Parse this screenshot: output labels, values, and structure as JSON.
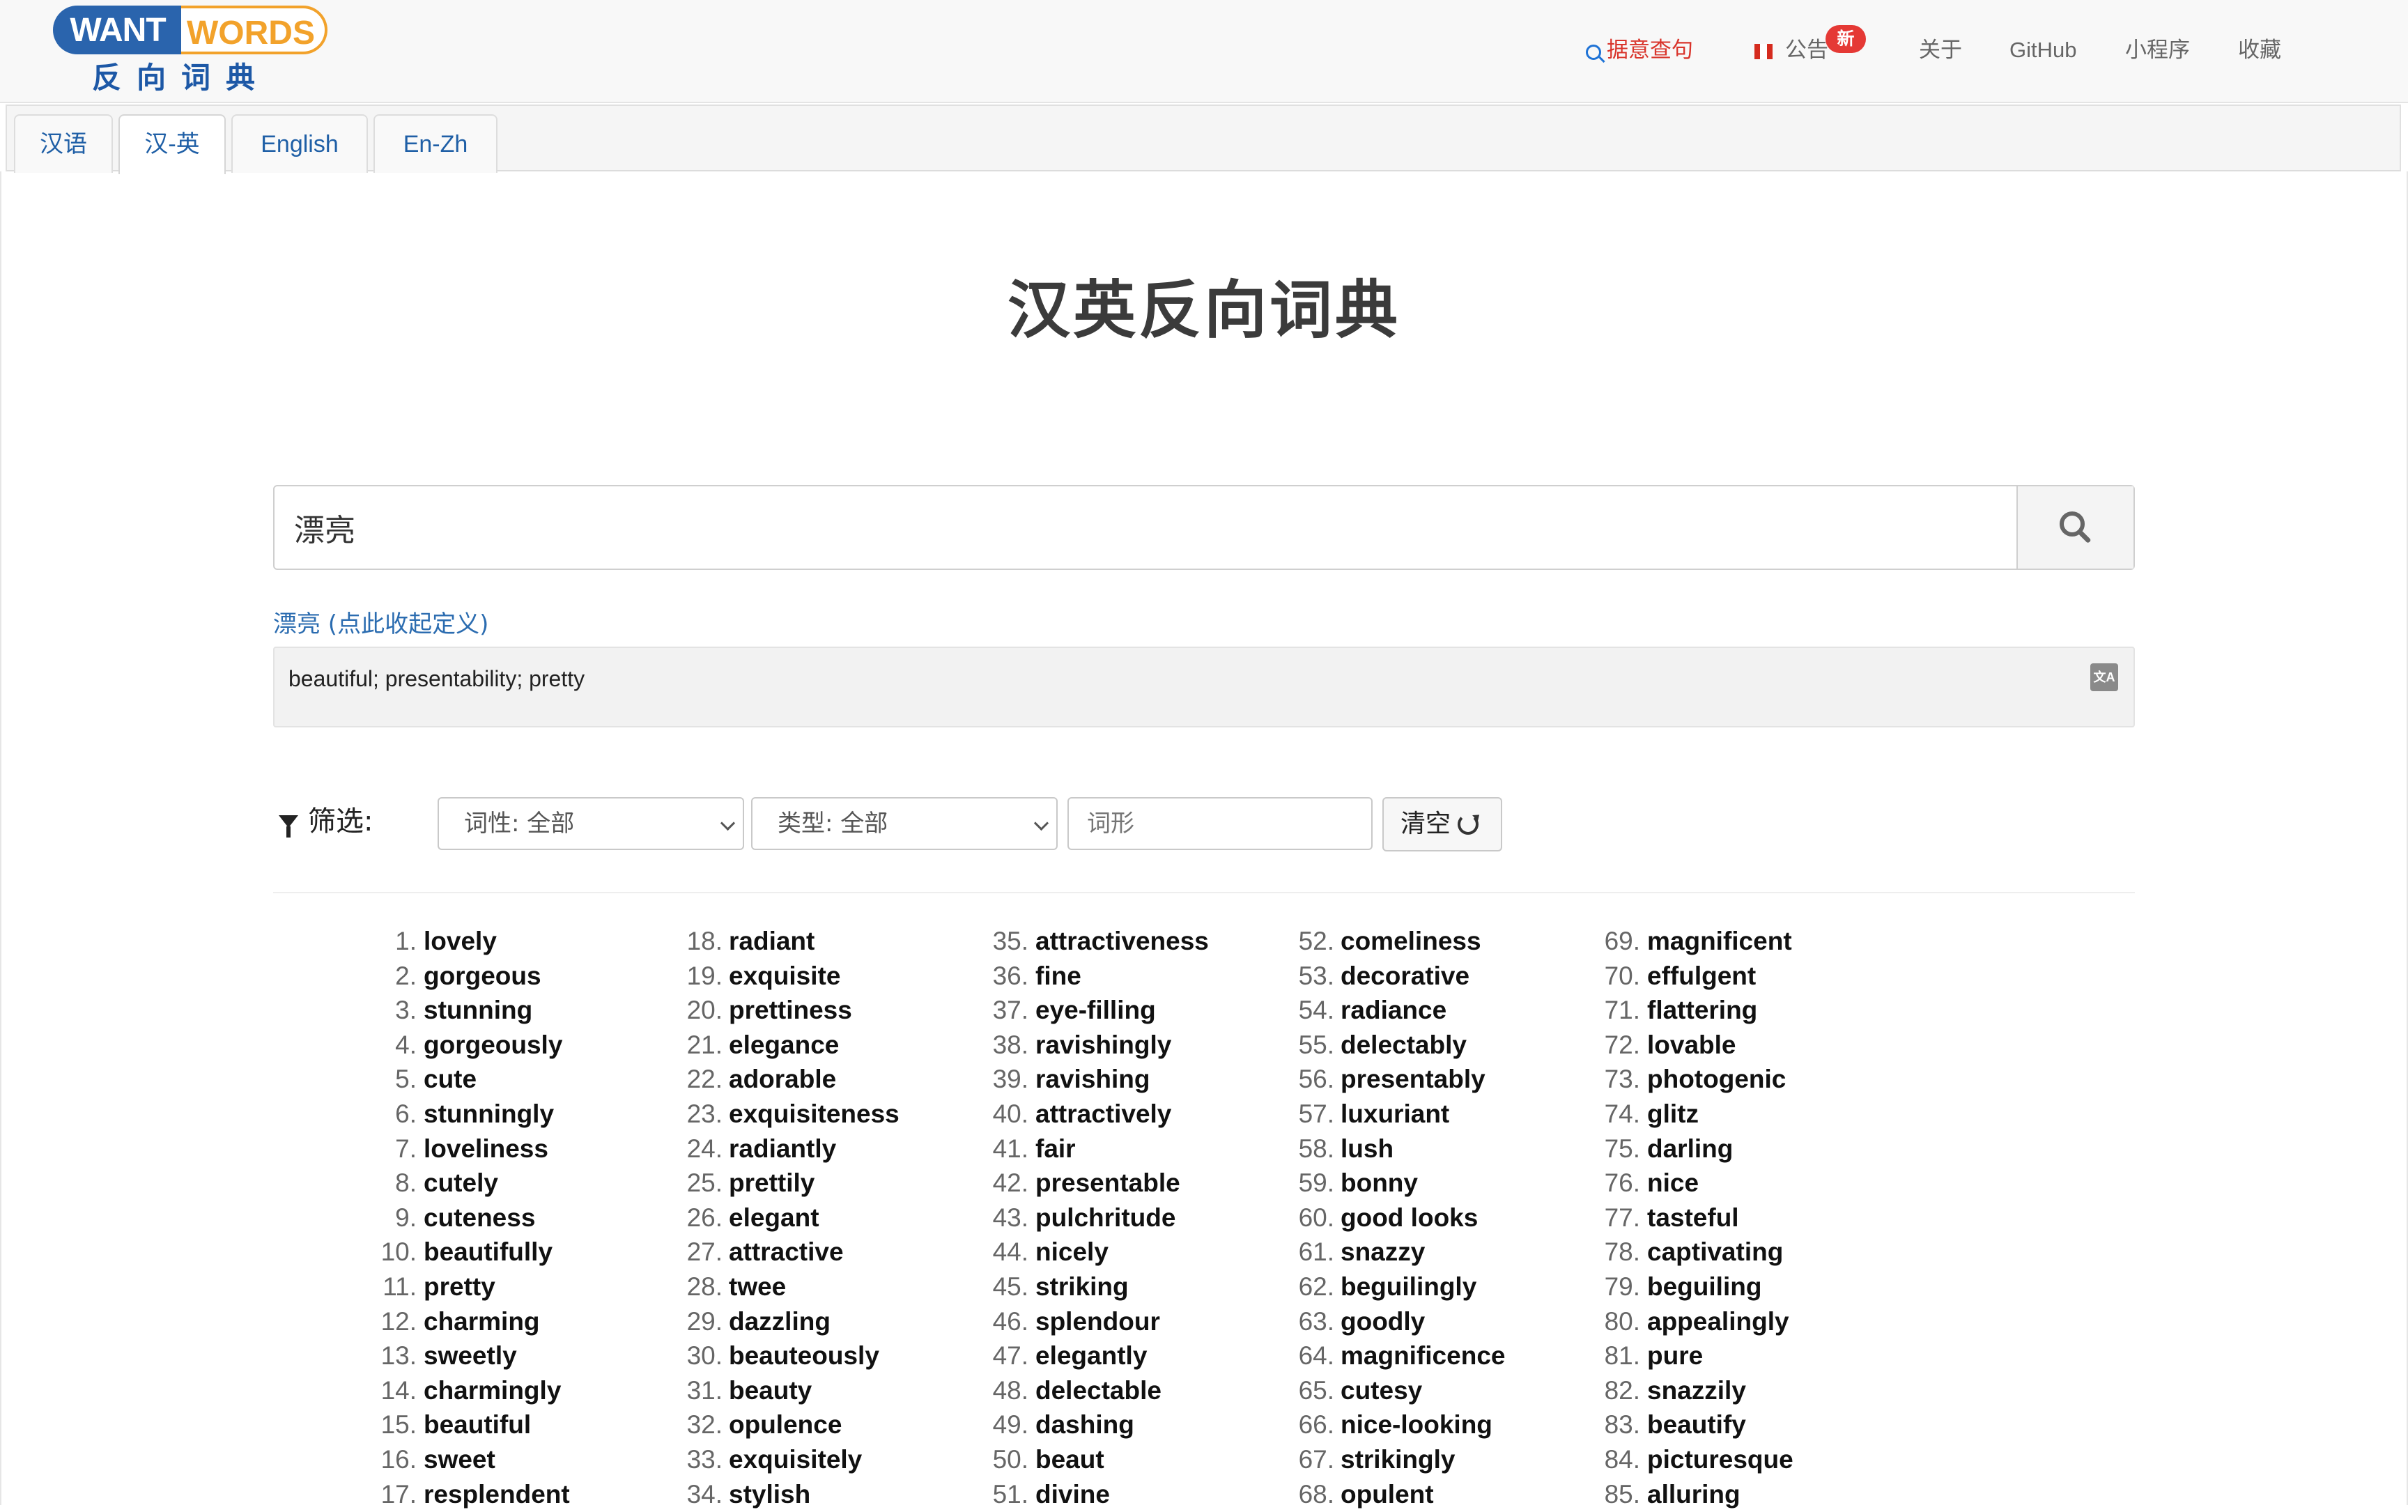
{
  "navbar": {
    "logo_want": "WANT",
    "logo_words": "WORDS",
    "logo_sub": "反向词典",
    "links": [
      {
        "label": "据意查句",
        "name": "nav-search-sentence",
        "accent": "#d9342b"
      },
      {
        "label": "公告",
        "name": "nav-announcement"
      },
      {
        "label": "关于",
        "name": "nav-about"
      },
      {
        "label": "GitHub",
        "name": "nav-github"
      },
      {
        "label": "小程序",
        "name": "nav-miniprogram"
      },
      {
        "label": "收藏",
        "name": "nav-favorites"
      }
    ],
    "new_badge": "新"
  },
  "tabs": [
    {
      "label": "汉语",
      "active": false
    },
    {
      "label": "汉-英",
      "active": true
    },
    {
      "label": "English",
      "active": false
    },
    {
      "label": "En-Zh",
      "active": false
    }
  ],
  "title": "汉英反向词典",
  "search": {
    "value": "漂亮",
    "icon": "search-icon"
  },
  "definition": {
    "toggle": "漂亮 (点此收起定义)",
    "text": "beautiful; presentability; pretty",
    "translate_icon": "translate-icon"
  },
  "filter": {
    "label": "筛选:",
    "pos_select": "词性: 全部",
    "type_select": "类型: 全部",
    "form_placeholder": "词形",
    "clear_button": "清空"
  },
  "colors": {
    "link": "#1f5fa6",
    "accent_red": "#d9342b",
    "highlight_strong": "#a9c8fb",
    "highlight_light": "#cfe0fd"
  },
  "results": [
    [
      "lovely",
      "gorgeous",
      "stunning",
      "gorgeously",
      "cute",
      "stunningly",
      "loveliness",
      "cutely",
      "cuteness",
      "beautifully",
      "pretty",
      "charming",
      "sweetly",
      "charmingly",
      "beautiful",
      "sweet",
      "resplendent"
    ],
    [
      "radiant",
      "exquisite",
      "prettiness",
      "elegance",
      "adorable",
      "exquisiteness",
      "radiantly",
      "prettily",
      "elegant",
      "attractive",
      "twee",
      "dazzling",
      "beauteously",
      "beauty",
      "opulence",
      "exquisitely",
      "stylish"
    ],
    [
      "attractiveness",
      "fine",
      "eye-filling",
      "ravishingly",
      "ravishing",
      "attractively",
      "fair",
      "presentable",
      "pulchritude",
      "nicely",
      "striking",
      "splendour",
      "elegantly",
      "delectable",
      "dashing",
      "beaut",
      "divine"
    ],
    [
      "comeliness",
      "decorative",
      "radiance",
      "delectably",
      "presentably",
      "luxuriant",
      "lush",
      "bonny",
      "good looks",
      "snazzy",
      "beguilingly",
      "goodly",
      "magnificence",
      "cutesy",
      "nice-looking",
      "strikingly",
      "opulent"
    ],
    [
      "magnificent",
      "effulgent",
      "flattering",
      "lovable",
      "photogenic",
      "glitz",
      "darling",
      "nice",
      "tasteful",
      "captivating",
      "beguiling",
      "appealingly",
      "pure",
      "snazzily",
      "beautify",
      "picturesque",
      "alluring"
    ]
  ]
}
